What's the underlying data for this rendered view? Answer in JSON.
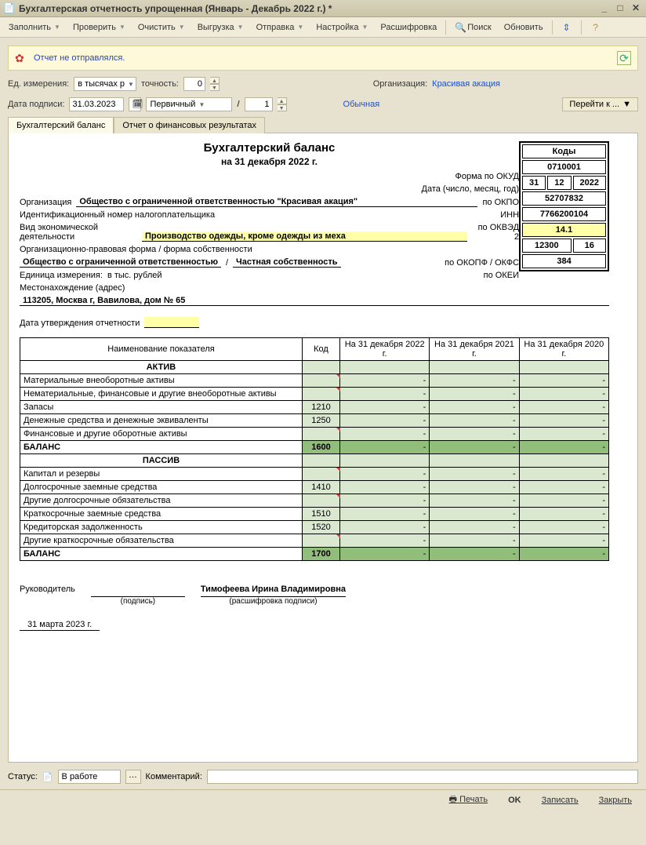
{
  "window": {
    "title": "Бухгалтерская отчетность упрощенная (Январь - Декабрь 2022 г.) *"
  },
  "toolbar": {
    "fill": "Заполнить",
    "check": "Проверить",
    "clear": "Очистить",
    "export": "Выгрузка",
    "send": "Отправка",
    "setup": "Настройка",
    "decode": "Расшифровка",
    "search": "Поиск",
    "refresh": "Обновить"
  },
  "notif": {
    "text": "Отчет не отправлялся."
  },
  "params": {
    "unit_label": "Ед. измерения:",
    "unit_value": "в тысячах р",
    "prec_label": "точность:",
    "prec_value": "0",
    "org_label": "Организация:",
    "org_value": "Красивая акация",
    "date_label": "Дата подписи:",
    "date_value": "31.03.2023",
    "kind_value": "Первичный",
    "slash": "/",
    "num_value": "1",
    "normal": "Обычная",
    "goto": "Перейти к ..."
  },
  "tabs": {
    "t1": "Бухгалтерский баланс",
    "t2": "Отчет о финансовых результатах"
  },
  "doc": {
    "title": "Бухгалтерский баланс",
    "asof": "на 31 декабря 2022 г.",
    "codes_hdr": "Коды",
    "form_okud_lbl": "Форма по ОКУД",
    "okud": "0710001",
    "date_lbl": "Дата (число, месяц, год)",
    "d_d": "31",
    "d_m": "12",
    "d_y": "2022",
    "org_lbl": "Организация",
    "org_name": "Общество с ограниченной ответственностью \"Красивая акация\"",
    "okpo_lbl": "по ОКПО",
    "okpo": "52707832",
    "inn_lbl": "Идентификационный номер налогоплательщика",
    "inn_r": "ИНН",
    "inn": "7766200104",
    "act_lbl": "Вид экономической деятельности",
    "act_val": "Производство одежды, кроме одежды из меха",
    "okved_lbl": "по ОКВЭД 2",
    "okved": "14.1",
    "opf_lbl": "Организационно-правовая форма / форма собственности",
    "opf_val1": "Общество с ограниченной ответственностью",
    "opf_sep": "/",
    "opf_val2": "Частная собственность",
    "okopf_lbl": "по ОКОПФ / ОКФС",
    "okopf1": "12300",
    "okopf2": "16",
    "unit_lbl": "Единица измерения:",
    "unit_val": "в тыс. рублей",
    "okei_lbl": "по ОКЕИ",
    "okei": "384",
    "addr_lbl": "Местонахождение (адрес)",
    "addr_val": "113205, Москва г, Вавилова, дом № 65",
    "approve_lbl": "Дата утверждения отчетности"
  },
  "table": {
    "h1": "Наименование показателя",
    "h2": "Код",
    "h3": "На 31 декабря 2022 г.",
    "h4": "На 31 декабря 2021 г.",
    "h5": "На 31 декабря 2020 г.",
    "aktiv": "АКТИВ",
    "passiv": "ПАССИВ",
    "rows_a": [
      {
        "name": "Материальные внеоборотные активы",
        "code": ""
      },
      {
        "name": "Нематериальные, финансовые и другие внеоборотные активы",
        "code": ""
      },
      {
        "name": "Запасы",
        "code": "1210"
      },
      {
        "name": "Денежные средства и денежные эквиваленты",
        "code": "1250"
      },
      {
        "name": "Финансовые и другие оборотные активы",
        "code": ""
      }
    ],
    "bal_a": {
      "name": "БАЛАНС",
      "code": "1600"
    },
    "rows_p": [
      {
        "name": "Капитал и резервы",
        "code": ""
      },
      {
        "name": "Долгосрочные заемные средства",
        "code": "1410"
      },
      {
        "name": "Другие долгосрочные обязательства",
        "code": ""
      },
      {
        "name": "Краткосрочные заемные средства",
        "code": "1510"
      },
      {
        "name": "Кредиторская задолженность",
        "code": "1520"
      },
      {
        "name": "Другие краткосрочные обязательства",
        "code": ""
      }
    ],
    "bal_p": {
      "name": "БАЛАНС",
      "code": "1700"
    }
  },
  "sign": {
    "head_lbl": "Руководитель",
    "sig_sub": "(подпись)",
    "name": "Тимофеева Ирина Владимировна",
    "name_sub": "(расшифровка подписи)",
    "date": "31 марта 2023 г."
  },
  "status": {
    "label": "Статус:",
    "value": "В работе",
    "comment_lbl": "Комментарий:"
  },
  "footer": {
    "print": "Печать",
    "ok": "OK",
    "save": "Записать",
    "close": "Закрыть"
  }
}
